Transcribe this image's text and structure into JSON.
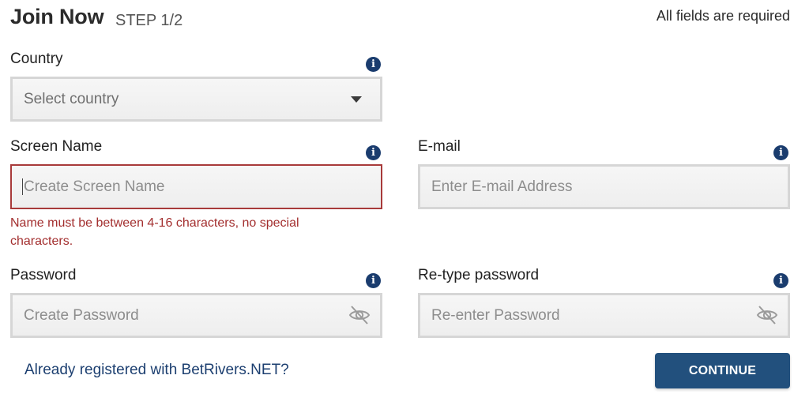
{
  "header": {
    "title": "Join Now",
    "step": "STEP 1/2",
    "required_note": "All fields are required"
  },
  "country": {
    "label": "Country",
    "value": "Select country",
    "info_icon": "info-icon"
  },
  "screen_name": {
    "label": "Screen Name",
    "placeholder": "Create Screen Name",
    "error": "Name must be between 4-16 characters, no special characters.",
    "info_icon": "info-icon"
  },
  "email": {
    "label": "E-mail",
    "placeholder": "Enter E-mail Address",
    "info_icon": "info-icon"
  },
  "password": {
    "label": "Password",
    "placeholder": "Create Password",
    "info_icon": "info-icon",
    "toggle_icon": "eye-off-icon"
  },
  "retype_password": {
    "label": "Re-type password",
    "placeholder": "Re-enter Password",
    "info_icon": "info-icon",
    "toggle_icon": "eye-off-icon"
  },
  "footer": {
    "login_link": "Already registered with BetRivers.NET?",
    "continue_label": "CONTINUE"
  },
  "colors": {
    "primary": "#22507d",
    "info_icon": "#1a3c6e",
    "error": "#a83a3a",
    "link": "#1c3f70"
  }
}
